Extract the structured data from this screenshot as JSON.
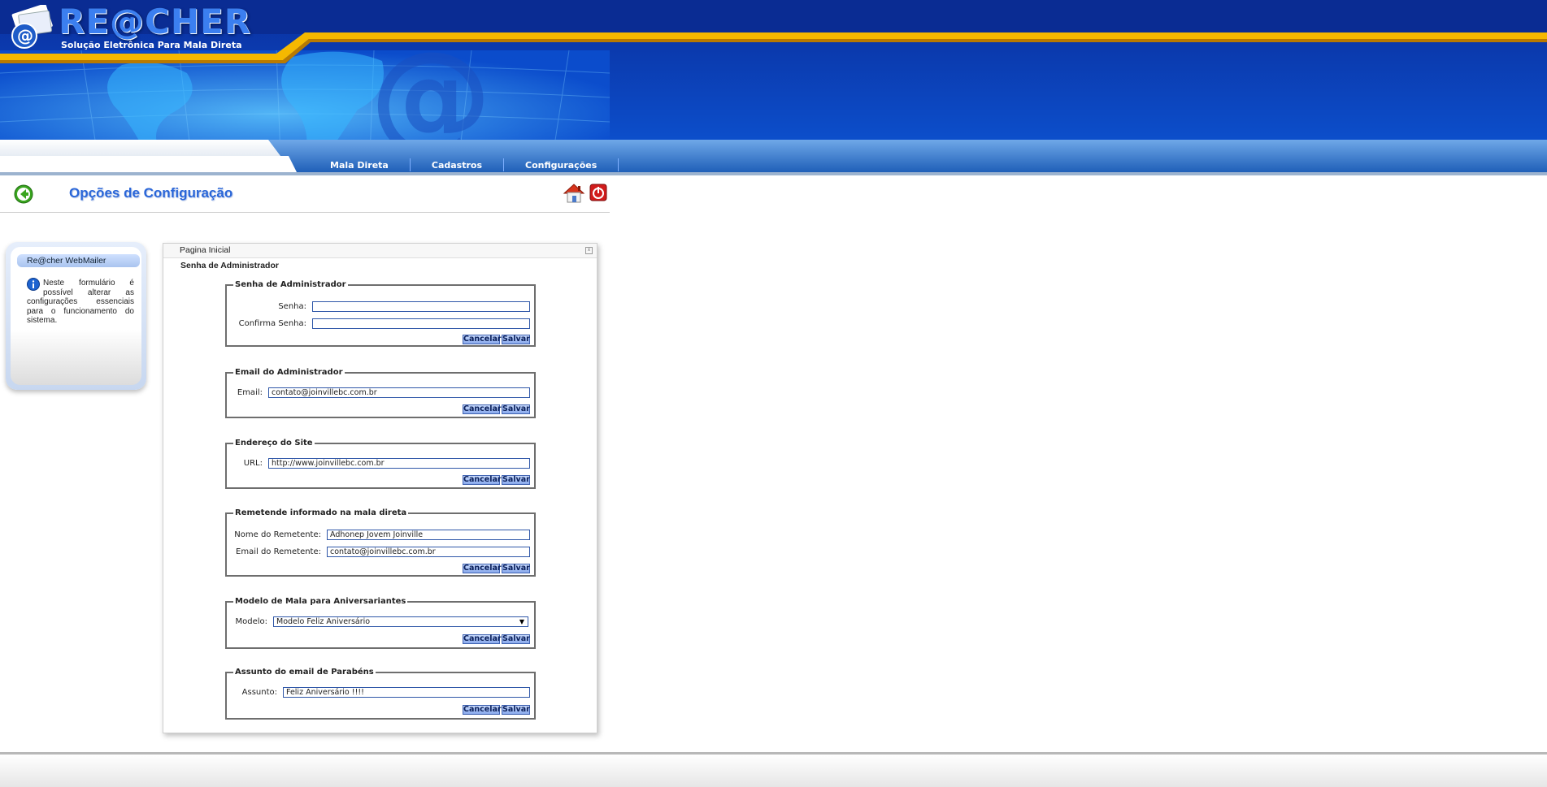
{
  "brand": {
    "name": "RE@CHER",
    "tagline": "Solução Eletrônica Para Mala Direta"
  },
  "nav": {
    "items": [
      "Mala Direta",
      "Cadastros",
      "Configurações"
    ]
  },
  "page": {
    "title": "Opções de Configuração"
  },
  "sidebar": {
    "header": "Re@cher WebMailer",
    "text": "Neste formulário é possível alterar as configurações essenciais para o funcionamento do sistema."
  },
  "panel": {
    "tab": "Pagina Inicial",
    "subtitle": "Senha de Administrador"
  },
  "buttons": {
    "cancel": "Cancelar",
    "save": "Salvar"
  },
  "sections": {
    "admin_password": {
      "legend": "Senha de Administrador",
      "password_label": "Senha:",
      "password_value": "",
      "confirm_label": "Confirma Senha:",
      "confirm_value": ""
    },
    "admin_email": {
      "legend": "Email do Administrador",
      "email_label": "Email:",
      "email_value": "contato@joinvillebc.com.br"
    },
    "site_address": {
      "legend": "Endereço do Site",
      "url_label": "URL:",
      "url_value": "http://www.joinvillebc.com.br"
    },
    "sender": {
      "legend": "Remetende informado na mala direta",
      "name_label": "Nome do Remetente:",
      "name_value": "Adhonep Jovem Joinville",
      "email_label": "Email do Remetente:",
      "email_value": "contato@joinvillebc.com.br"
    },
    "birthday_template": {
      "legend": "Modelo de Mala para Aniversariantes",
      "model_label": "Modelo:",
      "model_value": "Modelo Feliz Aniversário"
    },
    "birthday_subject": {
      "legend": "Assunto do email de Parabéns",
      "subject_label": "Assunto:",
      "subject_value": "Feliz Aniversário !!!!"
    }
  },
  "colors": {
    "header_blue": "#0a3db3",
    "accent_gold": "#f5b800",
    "title_blue": "#2a66d8"
  }
}
